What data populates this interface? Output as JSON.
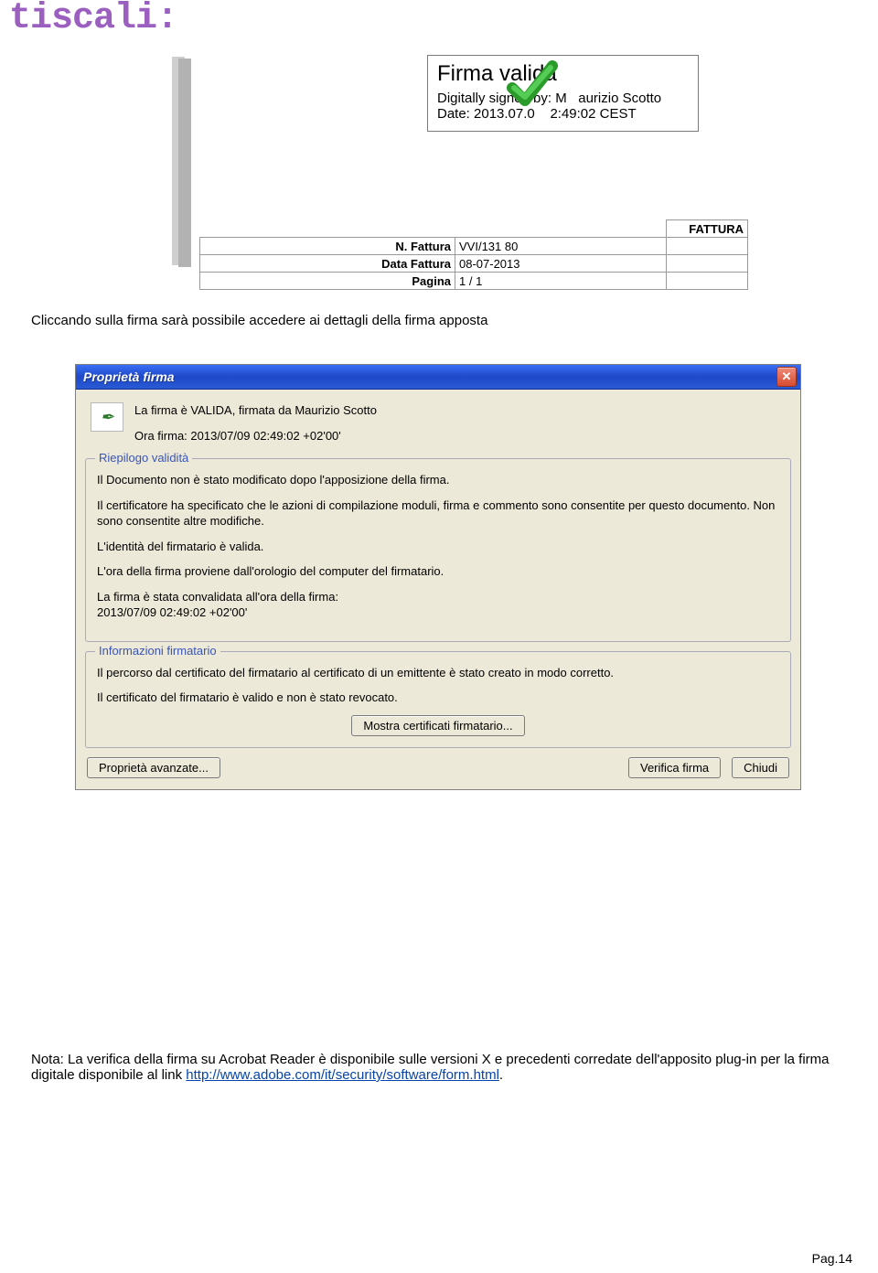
{
  "logo": "tiscali:",
  "invoice_preview": {
    "sig": {
      "title": "Firma valida",
      "signed_line_prefix": "Digitally signed by: ",
      "signed_name_left": "M",
      "signed_name_right": "aurizio Scotto",
      "date_line_prefix": "Date: 2013.07.0",
      "date_line_right": "2:49:02 CEST"
    },
    "header_right": "FATTURA",
    "rows": [
      {
        "label": "N. Fattura",
        "value": "VVI/131  80"
      },
      {
        "label": "Data Fattura",
        "value": "08-07-2013"
      },
      {
        "label": "Pagina",
        "value": "1 / 1"
      }
    ]
  },
  "body": {
    "line1": "Cliccando sulla firma sarà possibile accedere ai dettagli della firma apposta",
    "note_prefix": "Nota: La verifica della firma su Acrobat Reader è disponibile sulle versioni X e precedenti corredate dell'apposito plug-in per la firma digitale disponibile al link ",
    "note_link_text": "http://www.adobe.com/it/security/software/form.html",
    "note_suffix": "."
  },
  "dialog": {
    "title": "Proprietà firma",
    "close_glyph": "✕",
    "summary_line1": "La firma è VALIDA, firmata da Maurizio Scotto",
    "summary_line2": "Ora firma:  2013/07/09 02:49:02 +02'00'",
    "group1": {
      "legend": "Riepilogo validità",
      "p1": "Il Documento non è stato modificato dopo l'apposizione della firma.",
      "p2": "Il certificatore ha specificato che le azioni di compilazione moduli, firma e commento sono consentite per questo documento. Non sono consentite altre modifiche.",
      "p3": "L'identità del firmatario è valida.",
      "p4": "L'ora della firma proviene dall'orologio del computer del firmatario.",
      "p5": "La firma è stata convalidata all'ora della firma:\n2013/07/09 02:49:02 +02'00'"
    },
    "group2": {
      "legend": "Informazioni firmatario",
      "p1": "Il percorso dal certificato del firmatario al certificato di un emittente è stato creato in modo corretto.",
      "p2": "Il certificato del firmatario è valido e non è stato revocato.",
      "button": "Mostra certificati firmatario..."
    },
    "btn_adv": "Proprietà avanzate...",
    "btn_verify": "Verifica firma",
    "btn_close": "Chiudi"
  },
  "page_number": "Pag.14"
}
